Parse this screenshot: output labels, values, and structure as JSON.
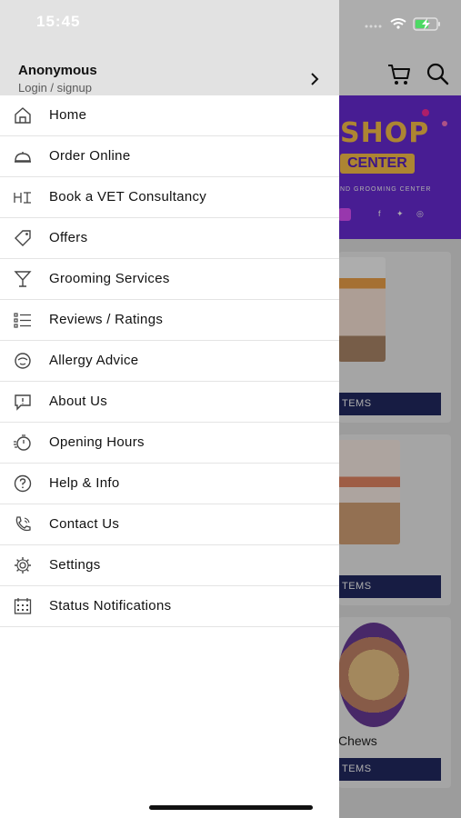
{
  "status_bar": {
    "time": "15:45"
  },
  "user": {
    "name": "Anonymous",
    "sub": "Login / signup"
  },
  "menu": [
    {
      "label": "Home",
      "icon": "home-icon"
    },
    {
      "label": "Order Online",
      "icon": "cloche-icon"
    },
    {
      "label": "Book a VET Consultancy",
      "icon": "vet-icon"
    },
    {
      "label": "Offers",
      "icon": "tag-icon"
    },
    {
      "label": "Grooming Services",
      "icon": "glass-icon"
    },
    {
      "label": "Reviews / Ratings",
      "icon": "list-icon"
    },
    {
      "label": "Allergy Advice",
      "icon": "allergy-icon"
    },
    {
      "label": "About Us",
      "icon": "chat-alert-icon"
    },
    {
      "label": "Opening Hours",
      "icon": "stopwatch-icon"
    },
    {
      "label": "Help & Info",
      "icon": "help-icon"
    },
    {
      "label": "Contact Us",
      "icon": "phone-icon"
    },
    {
      "label": "Settings",
      "icon": "gear-icon"
    },
    {
      "label": "Status Notifications",
      "icon": "calendar-icon"
    }
  ],
  "background": {
    "banner": {
      "shop": "SHOP",
      "center": "CENTER",
      "sub": "ND GROOMING CENTER"
    },
    "cards": [
      {
        "caption": "",
        "button": "TEMS"
      },
      {
        "caption": "",
        "button": "TEMS"
      },
      {
        "caption": "Chews",
        "button": "TEMS"
      }
    ]
  },
  "colors": {
    "banner": "#6a2bd9",
    "button": "#232a64",
    "drawer_header": "#e2e2e2"
  }
}
